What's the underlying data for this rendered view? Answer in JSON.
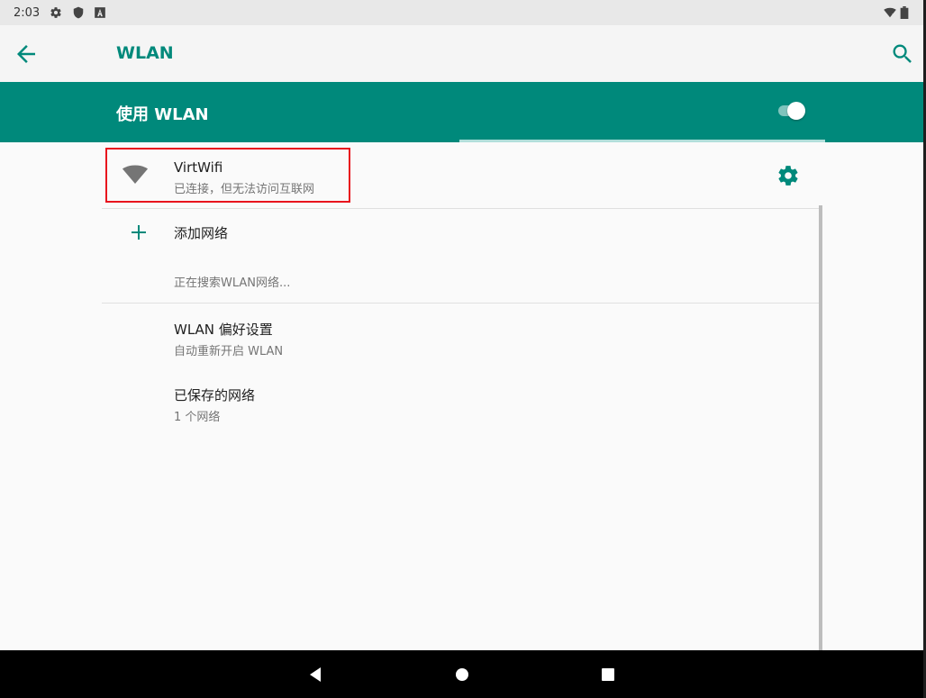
{
  "status_bar": {
    "time": "2:03",
    "icons": [
      "gear-icon",
      "shield-icon",
      "a-badge-icon",
      "wifi-signal-icon",
      "battery-icon"
    ]
  },
  "app_bar": {
    "title": "WLAN",
    "back_icon": "arrow-back-icon",
    "search_icon": "search-icon"
  },
  "master_switch": {
    "label": "使用 WLAN",
    "enabled": true
  },
  "networks": [
    {
      "name": "VirtWifi",
      "status": "已连接，但无法访问互联网",
      "icon": "wifi-icon",
      "settings_icon": "gear-icon",
      "highlighted": true
    }
  ],
  "add_network": {
    "label": "添加网络",
    "icon": "plus-icon"
  },
  "scanning_text": "正在搜索WLAN网络...",
  "preferences": [
    {
      "title": "WLAN 偏好设置",
      "subtitle": "自动重新开启 WLAN"
    },
    {
      "title": "已保存的网络",
      "subtitle": "1 个网络"
    }
  ],
  "nav_bar": {
    "buttons": [
      "back-triangle-icon",
      "home-circle-icon",
      "recents-square-icon"
    ]
  },
  "colors": {
    "accent": "#00897b",
    "highlight_border": "#e8141d",
    "background": "#fafafa"
  }
}
